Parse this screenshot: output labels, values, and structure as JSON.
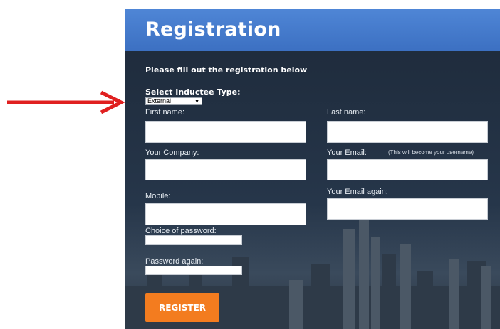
{
  "header": {
    "title": "Registration"
  },
  "form": {
    "intro": "Please fill out the registration below",
    "inductee_type_label": "Select Inductee Type:",
    "inductee_type_value": "External",
    "first_name_label": "First name:",
    "last_name_label": "Last name:",
    "company_label": "Your Company:",
    "email_label": "Your Email:",
    "email_note": "(This will become your username)",
    "email_again_label": "Your Email again:",
    "mobile_label": "Mobile:",
    "password_label": "Choice of password:",
    "password_again_label": "Password again:",
    "register_label": "REGISTER"
  },
  "colors": {
    "header_blue": "#3c70c2",
    "panel_dark": "#1d2a3a",
    "register_orange": "#f37c1f",
    "arrow_red": "#e02020"
  },
  "icons": {
    "arrow": "red-arrow-right-icon",
    "select_caret": "caret-down-icon"
  }
}
